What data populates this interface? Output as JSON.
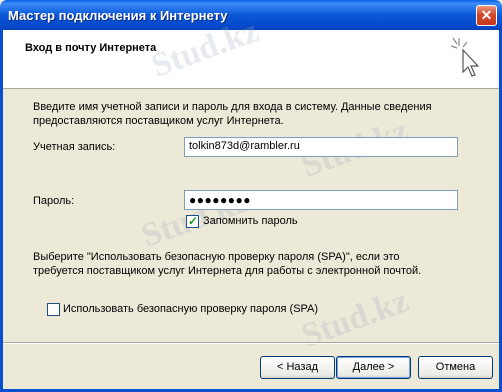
{
  "window": {
    "title": "Мастер подключения к Интернету",
    "close_glyph": "✕"
  },
  "header": {
    "title": "Вход в почту Интернета"
  },
  "description": "Введите имя учетной записи и пароль для входа в систему. Данные сведения предоставляются поставщиком услуг Интернета.",
  "account": {
    "label": "Учетная запись:",
    "value": "tolkin873d@rambler.ru"
  },
  "password": {
    "label": "Пароль:",
    "value": "●●●●●●●●"
  },
  "remember": {
    "label": "Запомнить пароль",
    "checked": true
  },
  "spa_description": "Выберите \"Использовать безопасную проверку пароля (SPA)\", если это требуется поставщиком услуг Интернета для работы с электронной почтой.",
  "spa": {
    "label": "Использовать безопасную проверку пароля (SPA)",
    "checked": false
  },
  "buttons": {
    "back": "< Назад",
    "next": "Далее >",
    "cancel": "Отмена"
  },
  "watermark": "Stud.kz"
}
